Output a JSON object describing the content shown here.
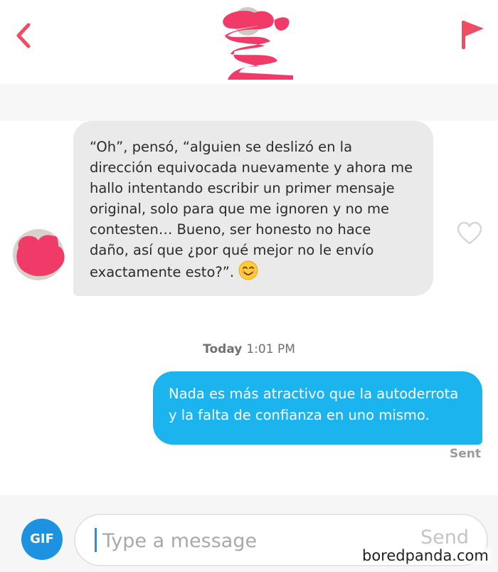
{
  "header": {
    "back_icon": "chevron-left-icon",
    "report_icon": "flag-icon",
    "avatar": "redacted-profile-avatar",
    "accent_color": "#ef4d64"
  },
  "incoming_message": {
    "text": "“Oh”, pensó, “alguien se deslizó en la\ndirección equivocada nuevamente y ahora me\nhallo intentando escribir un primer mensaje\noriginal, solo para que me ignoren y no me\ncontesten… Bueno, ser honesto no hace\ndaño, así que ¿por qué mejor no le envío\nexactamente esto?”.",
    "emoji_icon": "smiling-face-icon",
    "like_icon": "heart-outline-icon",
    "bubble_color": "#eaeaea"
  },
  "timestamp": {
    "day": "Today",
    "time": "1:01 PM"
  },
  "outgoing_message": {
    "text": "Nada es más atractivo que la autoderrota\ny la falta de confianza en uno mismo.",
    "status": "Sent",
    "bubble_color": "#1bb4ef"
  },
  "composer": {
    "gif_label": "GIF",
    "placeholder": "Type a message",
    "value": "",
    "send_label": "Send"
  },
  "watermark": "boredpanda.com"
}
